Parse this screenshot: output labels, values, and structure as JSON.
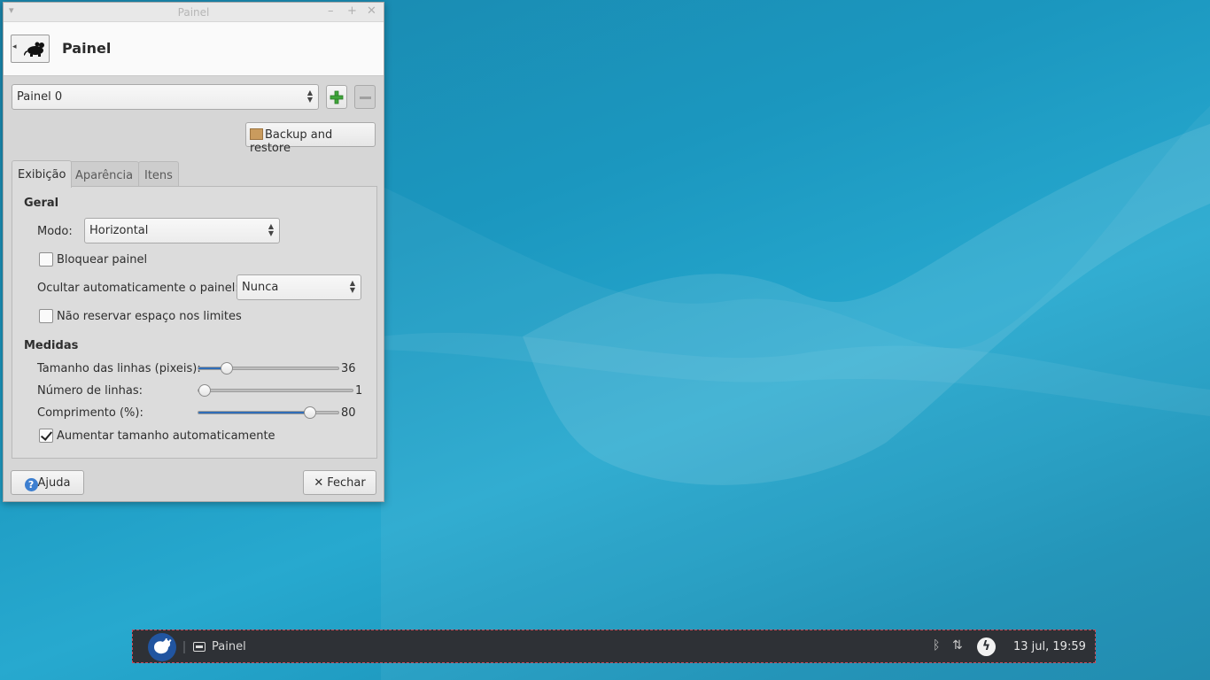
{
  "window": {
    "title": "Painel",
    "header_title": "Painel"
  },
  "panel_selector": {
    "value": "Painel 0"
  },
  "buttons": {
    "backup_restore": "Backup and restore",
    "help": "Ajuda",
    "close": "Fechar"
  },
  "tabs": [
    {
      "label": "Exibição",
      "active": true
    },
    {
      "label": "Aparência",
      "active": false
    },
    {
      "label": "Itens",
      "active": false
    }
  ],
  "general": {
    "heading": "Geral",
    "mode_label": "Modo:",
    "mode_value": "Horizontal",
    "lock_label": "Bloquear painel",
    "lock_checked": false,
    "autohide_label": "Ocultar automaticamente o painel:",
    "autohide_value": "Nunca",
    "no_reserve_label": "Não reservar espaço nos limites",
    "no_reserve_checked": false
  },
  "measures": {
    "heading": "Medidas",
    "row_size_label": "Tamanho das linhas (pixeis):",
    "row_size_value": "36",
    "row_size_fraction": 0.2,
    "rows_label": "Número de linhas:",
    "rows_value": "1",
    "rows_fraction": 0.0,
    "length_label": "Comprimento (%):",
    "length_value": "80",
    "length_fraction": 0.8,
    "autosize_label": "Aumentar tamanho automaticamente",
    "autosize_checked": true
  },
  "taskbar": {
    "task_label": "Painel",
    "clock": "13 jul, 19:59"
  },
  "colors": {
    "accent": "#2f6db8",
    "panel_bg": "#2e3136",
    "add_green": "#3fa53a"
  }
}
